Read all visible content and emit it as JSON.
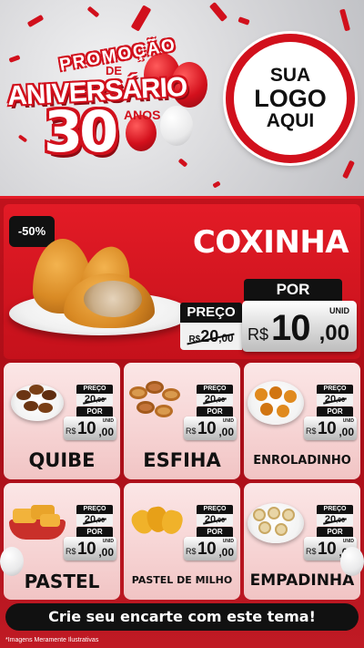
{
  "header": {
    "promo_word": "PROMOÇÃO",
    "promo_de": "DE",
    "promo_event": "ANIVERSÁRIO",
    "promo_number": "30",
    "promo_years": "ANOS",
    "logo_line1": "SUA",
    "logo_line2": "LOGO",
    "logo_line3": "AQUI"
  },
  "featured": {
    "discount": "-50%",
    "name": "COXINHA",
    "price_label": "PREÇO",
    "old_price_int": "20",
    "old_price_dec": ",00",
    "old_currency": "R$",
    "por_label": "POR",
    "currency": "R$",
    "new_price_int": "10",
    "new_price_dec": ",00",
    "unit": "UNID"
  },
  "products": [
    {
      "name": "QUIBE",
      "price_label": "PREÇO",
      "old_price_int": "20",
      "old_price_dec": ",00",
      "por_label": "POR",
      "currency": "R$",
      "new_price_int": "10",
      "new_price_dec": ",00",
      "unit": "UNID"
    },
    {
      "name": "ESFIHA",
      "price_label": "PREÇO",
      "old_price_int": "20",
      "old_price_dec": ",00",
      "por_label": "POR",
      "currency": "R$",
      "new_price_int": "10",
      "new_price_dec": ",00",
      "unit": "UNID"
    },
    {
      "name": "ENROLADINHO",
      "price_label": "PREÇO",
      "old_price_int": "20",
      "old_price_dec": ",00",
      "por_label": "POR",
      "currency": "R$",
      "new_price_int": "10",
      "new_price_dec": ",00",
      "unit": "UNID"
    },
    {
      "name": "PASTEL",
      "price_label": "PREÇO",
      "old_price_int": "20",
      "old_price_dec": ",00",
      "por_label": "POR",
      "currency": "R$",
      "new_price_int": "10",
      "new_price_dec": ",00",
      "unit": "UNID"
    },
    {
      "name": "PASTEL DE MILHO",
      "price_label": "PREÇO",
      "old_price_int": "20",
      "old_price_dec": ",00",
      "por_label": "POR",
      "currency": "R$",
      "new_price_int": "10",
      "new_price_dec": ",00",
      "unit": "UNID"
    },
    {
      "name": "EMPADINHA",
      "price_label": "PREÇO",
      "old_price_int": "20",
      "old_price_dec": ",00",
      "por_label": "POR",
      "currency": "R$",
      "new_price_int": "10",
      "new_price_dec": ",00",
      "unit": "UNID"
    }
  ],
  "footer": {
    "cta": "Crie seu encarte com este tema!",
    "disclaimer": "*Imagens Meramente Ilustrativas"
  },
  "colors": {
    "brand_red": "#d1101c",
    "panel_red": "#c1121c",
    "card_pink": "#f6d3d3",
    "tag_black": "#111111"
  }
}
